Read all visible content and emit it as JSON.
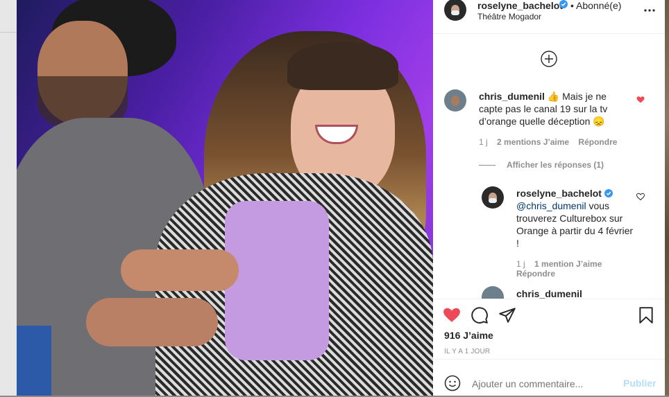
{
  "post": {
    "author": "roselyne_bachelot",
    "follow_status": "• Abonné(e)",
    "location": "Théâtre Mogador"
  },
  "comments": [
    {
      "user": "chris_dumenil",
      "text": "👍 Mais je ne capte pas le canal 19 sur la tv d’orange quelle déception 😞",
      "age": "1 j",
      "likes": "2 mentions J’aime",
      "reply": "Répondre",
      "liked": true,
      "view_replies": "Afficher les réponses (1)"
    },
    {
      "user": "roselyne_bachelot",
      "mention": "@chris_dumenil",
      "text": " vous trouverez Culturebox sur Orange à partir du 4 février !",
      "age": "1 j",
      "likes": "1 mention J’aime",
      "reply": "Répondre",
      "liked": false
    },
    {
      "user": "chris_dumenil"
    }
  ],
  "footer": {
    "likes": "916 J’aime",
    "posted": "IL Y A 1 JOUR",
    "comment_placeholder": "Ajouter un commentaire...",
    "publish": "Publier"
  },
  "colors": {
    "like_red": "#ed4956",
    "verified_blue": "#3897f0",
    "publish_disabled": "#b2dffc",
    "photo_purple": "#7c2fe0"
  }
}
